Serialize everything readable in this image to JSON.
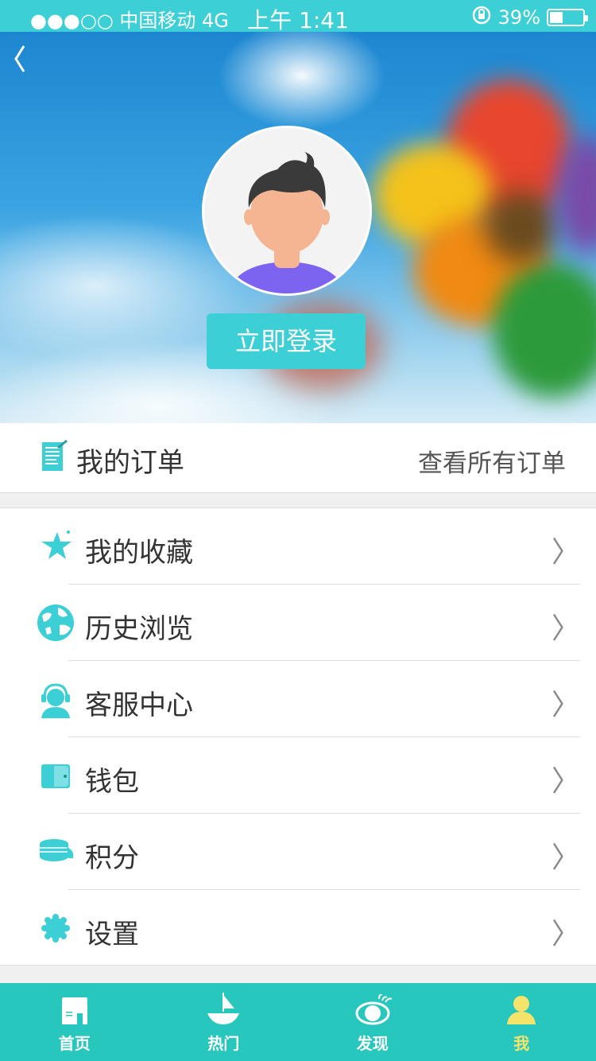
{
  "status_bar": {
    "carrier": "●●●○○ 中国移动 4G",
    "time": "上午 1:41",
    "battery": "39%",
    "battery_level": 0.39
  },
  "header": {
    "back_icon": "back-chevron-icon",
    "avatar_icon": "user-avatar-icon",
    "login_label": "立即登录"
  },
  "orders": {
    "title": "我的订单",
    "view_all": "查看所有订单",
    "icon": "order-list-icon"
  },
  "menu": [
    {
      "label": "我的收藏",
      "icon": "star-icon"
    },
    {
      "label": "历史浏览",
      "icon": "globe-icon"
    },
    {
      "label": "客服中心",
      "icon": "headset-icon"
    },
    {
      "label": "钱包",
      "icon": "wallet-icon"
    },
    {
      "label": "积分",
      "icon": "coins-icon"
    },
    {
      "label": "设置",
      "icon": "gear-icon"
    }
  ],
  "chevron": "〉",
  "tabs": [
    {
      "label": "首页",
      "icon": "home-icon",
      "active": false
    },
    {
      "label": "热门",
      "icon": "sailboat-icon",
      "active": false
    },
    {
      "label": "发现",
      "icon": "eye-icon",
      "active": false
    },
    {
      "label": "我",
      "icon": "person-icon",
      "active": true
    }
  ],
  "colors": {
    "accent": "#3ccfd6",
    "tabbar": "#27c7bd",
    "tab_active": "#f6e36b"
  }
}
